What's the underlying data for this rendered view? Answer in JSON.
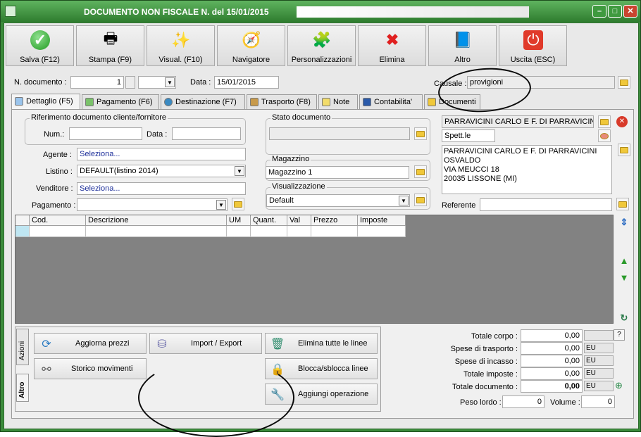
{
  "window": {
    "title": "DOCUMENTO NON FISCALE N. del 15/01/2015"
  },
  "toolbar": [
    {
      "label": "Salva (F12)",
      "icon": "check-icon"
    },
    {
      "label": "Stampa (F9)",
      "icon": "printer-icon"
    },
    {
      "label": "Visual. (F10)",
      "icon": "magic-wand-icon"
    },
    {
      "label": "Navigatore",
      "icon": "compass-icon"
    },
    {
      "label": "Personalizzazioni",
      "icon": "puzzle-icon"
    },
    {
      "label": "Elimina",
      "icon": "delete-x-icon"
    },
    {
      "label": "Altro",
      "icon": "altro-icon"
    },
    {
      "label": "Uscita (ESC)",
      "icon": "exit-icon"
    }
  ],
  "header": {
    "ndoc_label": "N. documento :",
    "ndoc_value": "1",
    "data_label": "Data :",
    "data_value": "15/01/2015",
    "causale_label": "Causale :",
    "causale_value": "provigioni"
  },
  "tabs": [
    {
      "label": "Dettaglio (F5)",
      "active": true
    },
    {
      "label": "Pagamento (F6)"
    },
    {
      "label": "Destinazione (F7)"
    },
    {
      "label": "Trasporto (F8)"
    },
    {
      "label": "Note"
    },
    {
      "label": "Contabilita'"
    },
    {
      "label": "Documenti"
    }
  ],
  "rif": {
    "title": "Riferimento documento cliente/fornitore",
    "num_label": "Num.:",
    "num_value": "",
    "data_label": "Data :",
    "data_value": ""
  },
  "form": {
    "agente_label": "Agente :",
    "agente_value": "Seleziona...",
    "listino_label": "Listino :",
    "listino_value": "DEFAULT(listino 2014)",
    "venditore_label": "Venditore :",
    "venditore_value": "Seleziona...",
    "pagamento_label": "Pagamento :",
    "pagamento_value": ""
  },
  "stato": {
    "title": "Stato documento",
    "value": ""
  },
  "magazzino": {
    "title": "Magazzino",
    "value": "Magazzino 1"
  },
  "visualizzazione": {
    "title": "Visualizzazione",
    "value": "Default"
  },
  "cliente": {
    "name": "PARRAVICINI CARLO E F. DI PARRAVICINI",
    "salutation": "Spett.le",
    "address": [
      "PARRAVICINI CARLO E F. DI PARRAVICINI",
      "OSVALDO",
      "VIA MEUCCI 18",
      "20035 LISSONE (MI)"
    ],
    "referente_label": "Referente",
    "referente_value": ""
  },
  "grid": {
    "columns": [
      "Cod.",
      "Descrizione",
      "UM",
      "Quant.",
      "Val",
      "Prezzo",
      "Imposte"
    ]
  },
  "actions": {
    "vtabs": [
      "Azioni",
      "Altro"
    ],
    "buttons": [
      {
        "label": "Aggiorna prezzi",
        "icon": "refresh-icon"
      },
      {
        "label": "Import / Export",
        "icon": "database-icon"
      },
      {
        "label": "Elimina tutte le linee",
        "icon": "trash-icon"
      },
      {
        "label": "Storico movimenti",
        "icon": "binoculars-icon"
      },
      {
        "label": "Blocca/sblocca linee",
        "icon": "lock-icon"
      },
      {
        "label": "Aggiungi operazione",
        "icon": "wrench-icon"
      }
    ]
  },
  "totals": {
    "rows": [
      {
        "label": "Totale corpo :",
        "value": "0,00",
        "unit": ""
      },
      {
        "label": "Spese di trasporto :",
        "value": "0,00",
        "unit": "EU"
      },
      {
        "label": "Spese di incasso :",
        "value": "0,00",
        "unit": "EU"
      },
      {
        "label": "Totale imposte :",
        "value": "0,00",
        "unit": "EU"
      },
      {
        "label": "Totale documento :",
        "value": "0,00",
        "unit": "EU"
      }
    ],
    "help": "?",
    "peso_label": "Peso lordo :",
    "peso_value": "0",
    "volume_label": "Volume :",
    "volume_value": "0"
  }
}
